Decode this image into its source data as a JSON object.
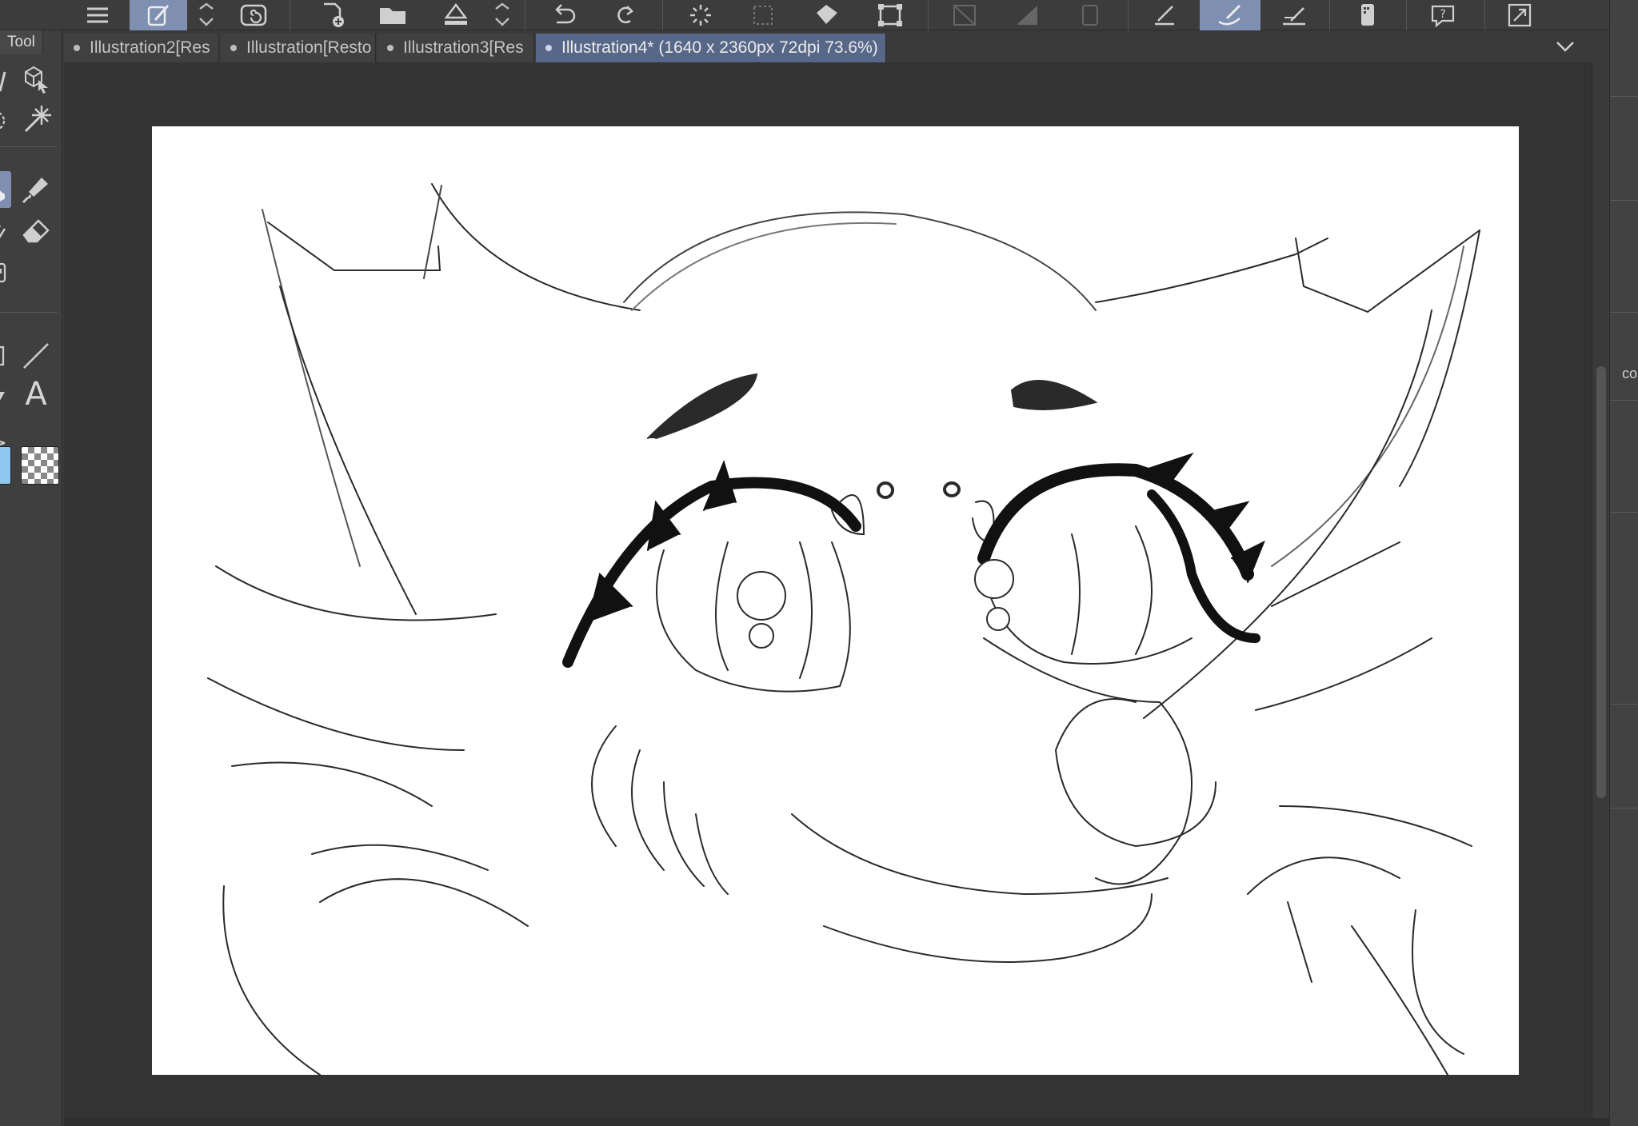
{
  "toolbar": {
    "buttons": [
      {
        "name": "menu-icon"
      },
      {
        "name": "edit-brush-icon",
        "active": true
      },
      {
        "name": "chevron-updown-icon"
      },
      {
        "name": "spiral-icon"
      },
      {
        "name": "new-file-icon"
      },
      {
        "name": "open-folder-icon"
      },
      {
        "name": "save-icon"
      },
      {
        "name": "chevron-updown-icon"
      },
      {
        "name": "undo-icon"
      },
      {
        "name": "redo-icon"
      },
      {
        "name": "loading-spinner-icon"
      },
      {
        "name": "clear-selection-icon"
      },
      {
        "name": "fill-icon"
      },
      {
        "name": "transform-icon"
      },
      {
        "name": "ruler-off-icon"
      },
      {
        "name": "gradient-icon"
      },
      {
        "name": "frame-icon"
      },
      {
        "name": "edit-check-icon"
      },
      {
        "name": "brush-stroke-icon",
        "active": true
      },
      {
        "name": "ruler-pen-icon"
      },
      {
        "name": "phone-icon"
      },
      {
        "name": "help-icon"
      },
      {
        "name": "expand-icon"
      }
    ]
  },
  "tool_panel": {
    "tab_label": "Tool",
    "tools": [
      "pen-partial-icon",
      "3d-object-icon",
      "lasso-partial-icon",
      "magic-wand-icon",
      "brush-partial-icon",
      "marker-icon",
      "airbrush-partial-icon",
      "eraser-icon",
      "figure-partial-icon",
      "rect-partial-icon",
      "line-icon",
      "triangle-partial-icon",
      "text-tool-icon",
      "arrow-partial-icon"
    ],
    "text_tool_glyph": "A",
    "main_color": "#8ec8f0"
  },
  "doc_tabs": [
    {
      "label": "Illustration2[Res",
      "active": false
    },
    {
      "label": "Illustration[Resto",
      "active": false
    },
    {
      "label": "Illustration3[Res",
      "active": false
    },
    {
      "label": "Illustration4* (1640 x 2360px 72dpi 73.6%)",
      "active": true
    }
  ],
  "right_panel": {
    "labels": [
      "co"
    ]
  },
  "colors": {
    "active_accent": "#7f8fb2",
    "active_tab": "#566788",
    "canvas_bg": "#333333",
    "paper": "#ffffff"
  }
}
